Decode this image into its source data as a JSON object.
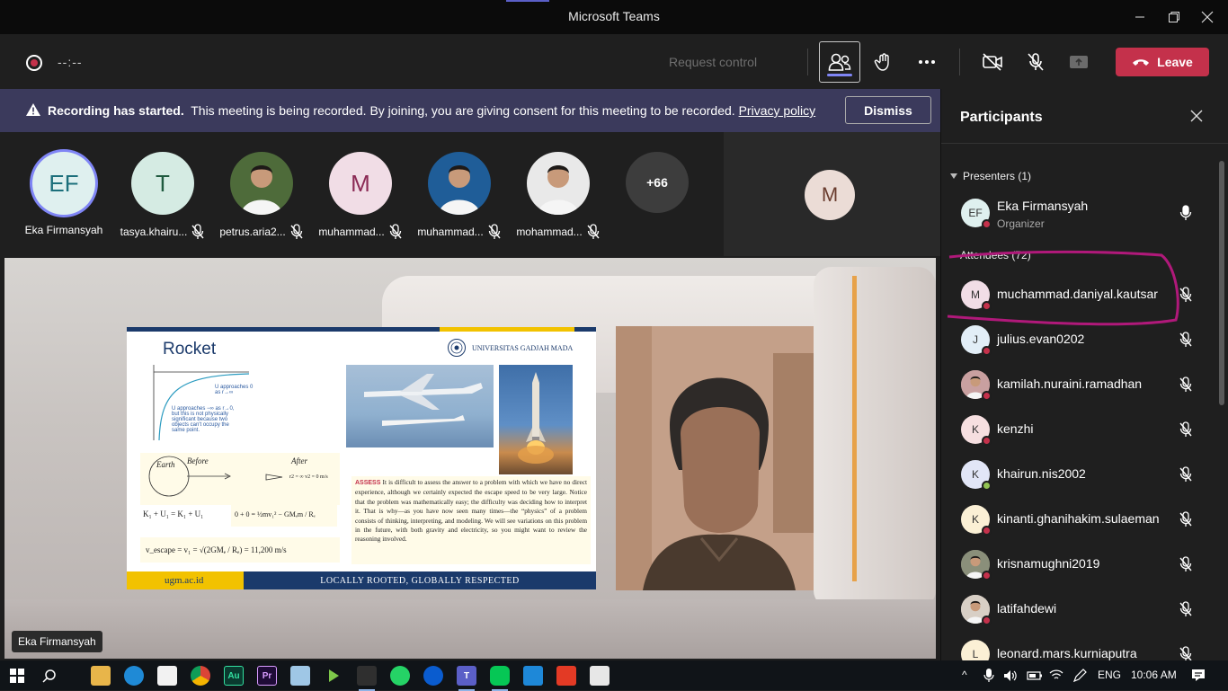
{
  "window": {
    "title": "Microsoft Teams",
    "minimize_icon": "minimize-icon",
    "maximize_icon": "restore-icon",
    "close_icon": "close-icon"
  },
  "toolbar": {
    "recording_timer": "--:--",
    "request_control_label": "Request control",
    "leave_label": "Leave",
    "colors": {
      "leave": "#c4314b",
      "accent": "#7f85f5"
    }
  },
  "banner": {
    "title": "Recording has started.",
    "message": "This meeting is being recorded. By joining, you are giving consent for this meeting to be recorded.",
    "link": "Privacy policy",
    "dismiss_label": "Dismiss"
  },
  "gallery": {
    "tiles": [
      {
        "initials": "EF",
        "name": "Eka Firmansyah",
        "muted": false,
        "bg": "#dff0ef",
        "fg": "#1c6f7b"
      },
      {
        "initials": "T",
        "name": "tasya.khairu...",
        "muted": true,
        "bg": "#d5ebe3",
        "fg": "#1f5a3f"
      },
      {
        "initials": "",
        "name": "petrus.aria2...",
        "muted": true,
        "photo": true
      },
      {
        "initials": "M",
        "name": "muhammad...",
        "muted": true,
        "bg": "#f1dde6",
        "fg": "#8b2a55"
      },
      {
        "initials": "",
        "name": "muhammad...",
        "muted": true,
        "photo": true
      },
      {
        "initials": "",
        "name": "mohammad...",
        "muted": true,
        "photo": true
      }
    ],
    "overflow_count": "+66",
    "right_avatar_initial": "M"
  },
  "stage": {
    "presenter_name": "Eka Firmansyah",
    "slide": {
      "title": "Rocket",
      "university": "UNIVERSITAS GADJAH MADA",
      "graph_note_1": "U approaches 0 as r→∞",
      "graph_note_2": "U approaches −∞ as r→0, but this is not physically significant because two objects can't occupy the same point.",
      "sketch_before": "Before",
      "sketch_after": "After",
      "sketch_earth": "Earth",
      "sketch_after_vals": "r2 = ∞  v2 = 0 m/s",
      "eq1": "K₁ + U₁ = K₁ + U₁",
      "eq2": "0 + 0 = ½mv₁² − GMₑm / Rₑ",
      "eq3": "v_escape = v₁ = √(2GMₑ / Rₑ) = 11,200 m/s",
      "assess_keyword": "ASSESS",
      "assess_text": "It is difficult to assess the answer to a problem with which we have no direct experience, although we certainly expected the escape speed to be very large. Notice that the problem was mathematically easy; the difficulty was deciding how to interpret it. That is why—as you have now seen many times—the “physics” of a problem consists of thinking, interpreting, and modeling. We will see variations on this problem in the future, with both gravity and electricity, so you might want to review the reasoning involved.",
      "footer_left": "ugm.ac.id",
      "footer_right": "LOCALLY ROOTED, GLOBALLY RESPECTED"
    }
  },
  "participants": {
    "title": "Participants",
    "presenters_label": "Presenters (1)",
    "attendees_label": "Attendees (72)",
    "presenters": [
      {
        "initials": "EF",
        "name": "Eka Firmansyah",
        "role": "Organizer",
        "mic": "on",
        "bg": "#dff0ef",
        "status": "away"
      }
    ],
    "attendees": [
      {
        "initials": "M",
        "name": "muchammad.daniyal.kautsar",
        "bg": "#f1dde6",
        "status": "busy"
      },
      {
        "initials": "J",
        "name": "julius.evan0202",
        "bg": "#e2eef7",
        "status": "busy"
      },
      {
        "initials": "",
        "name": "kamilah.nuraini.ramadhan",
        "photo": true,
        "bg": "#c9a0a0",
        "status": "busy"
      },
      {
        "initials": "K",
        "name": "kenzhi",
        "bg": "#f6dfe0",
        "status": "busy"
      },
      {
        "initials": "K",
        "name": "khairun.nis2002",
        "bg": "#e2e6f7",
        "status": "available"
      },
      {
        "initials": "K",
        "name": "kinanti.ghanihakim.sulaeman",
        "bg": "#fbf0d5",
        "status": "busy"
      },
      {
        "initials": "",
        "name": "krisnamughni2019",
        "photo": true,
        "bg": "#8a8f7a",
        "status": "busy"
      },
      {
        "initials": "",
        "name": "latifahdewi",
        "photo": true,
        "bg": "#d8cfc5",
        "status": "busy"
      },
      {
        "initials": "L",
        "name": "leonard.mars.kurniaputra",
        "bg": "#fbf0d5",
        "status": "busy"
      }
    ],
    "highlight_color": "#b0197a"
  },
  "taskbar": {
    "apps": [
      "start-icon",
      "search-icon",
      "file-explorer-icon",
      "edge-icon",
      "store-icon",
      "chrome-icon",
      "audition-icon",
      "premiere-icon",
      "notepad-icon",
      "plex-icon",
      "app-icon",
      "whatsapp-icon",
      "webex-icon",
      "teams-icon",
      "line-icon",
      "vscode-icon",
      "acrobat-icon",
      "image-app-icon"
    ],
    "language": "ENG",
    "time": "10:06 AM"
  }
}
